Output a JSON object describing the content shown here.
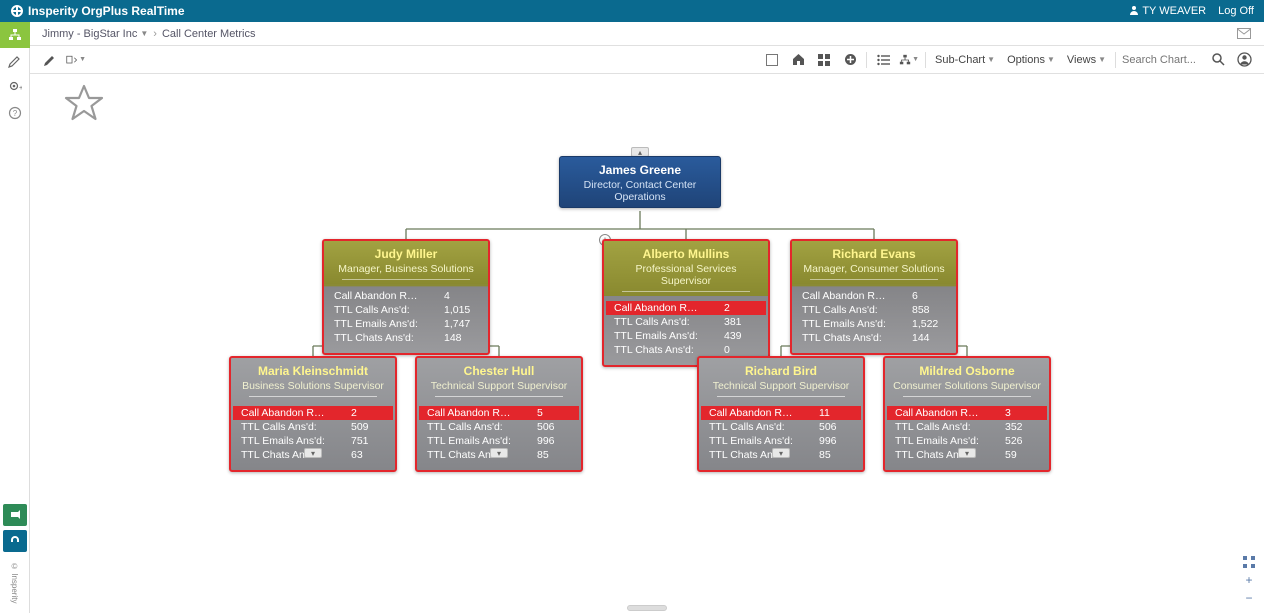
{
  "brand": "Insperity OrgPlus RealTime",
  "user_label": "TY WEAVER",
  "logoff": "Log Off",
  "breadcrumb": {
    "org": "Jimmy - BigStar Inc",
    "page": "Call Center Metrics"
  },
  "toolbar": {
    "subchart": "Sub-Chart",
    "options": "Options",
    "views": "Views",
    "search_placeholder": "Search Chart..."
  },
  "metric_labels": {
    "abandon": "Call Abandon R…",
    "calls": "TTL Calls Ans'd:",
    "emails": "TTL Emails Ans'd:",
    "chats": "TTL Chats Ans'd:"
  },
  "nodes": {
    "root": {
      "name": "James Greene",
      "title": "Director, Contact Center Operations"
    },
    "l1": [
      {
        "name": "Judy Miller",
        "title": "Manager, Business Solutions",
        "abandon": "4",
        "alert": false,
        "calls": "1,015",
        "emails": "1,747",
        "chats": "148"
      },
      {
        "name": "Alberto Mullins",
        "title": "Professional Services Supervisor",
        "abandon": "2",
        "alert": true,
        "calls": "381",
        "emails": "439",
        "chats": "0"
      },
      {
        "name": "Richard Evans",
        "title": "Manager, Consumer Solutions",
        "abandon": "6",
        "alert": false,
        "calls": "858",
        "emails": "1,522",
        "chats": "144"
      }
    ],
    "l2a": [
      {
        "name": "Maria Kleinschmidt",
        "title": "Business Solutions Supervisor",
        "abandon": "2",
        "alert": true,
        "calls": "509",
        "emails": "751",
        "chats": "63"
      },
      {
        "name": "Chester Hull",
        "title": "Technical Support Supervisor",
        "abandon": "5",
        "alert": true,
        "calls": "506",
        "emails": "996",
        "chats": "85"
      }
    ],
    "l2b": [
      {
        "name": "Richard Bird",
        "title": "Technical Support Supervisor",
        "abandon": "11",
        "alert": true,
        "calls": "506",
        "emails": "996",
        "chats": "85"
      },
      {
        "name": "Mildred Osborne",
        "title": "Consumer Solutions Supervisor",
        "abandon": "3",
        "alert": true,
        "calls": "352",
        "emails": "526",
        "chats": "59"
      }
    ]
  },
  "copyright": "© Insperity"
}
